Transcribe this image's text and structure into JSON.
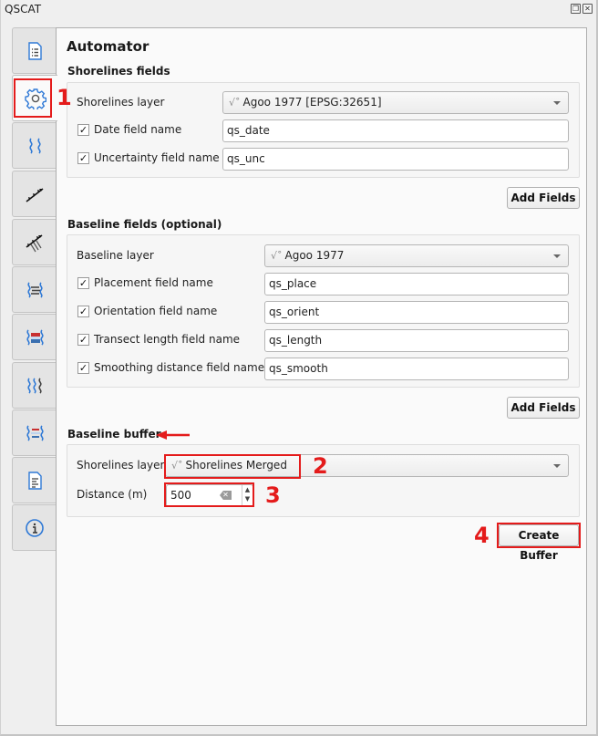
{
  "window": {
    "title": "QSCAT",
    "float_button": "restore-icon",
    "close_button": "close-icon"
  },
  "tabs": [
    {
      "name": "project-settings",
      "icon": "list-document-icon",
      "active": false
    },
    {
      "name": "automator",
      "icon": "gear-icon",
      "active": true
    },
    {
      "name": "shorelines",
      "icon": "shoreline-waves-icon",
      "active": false
    },
    {
      "name": "transects-cast",
      "icon": "transect-arrows-icon",
      "active": false
    },
    {
      "name": "transects-multi",
      "icon": "multi-transect-arrows-icon",
      "active": false
    },
    {
      "name": "shoreline-change",
      "icon": "shoreline-change-icon",
      "active": false
    },
    {
      "name": "area-change",
      "icon": "area-change-icon",
      "active": false
    },
    {
      "name": "forecasting",
      "icon": "triple-waves-icon",
      "active": false
    },
    {
      "name": "summary",
      "icon": "summary-change-icon",
      "active": false
    },
    {
      "name": "report",
      "icon": "report-document-icon",
      "active": false
    },
    {
      "name": "about",
      "icon": "info-icon",
      "active": false
    }
  ],
  "page": {
    "title": "Automator"
  },
  "shorelines_fields": {
    "title": "Shorelines fields",
    "layer_label": "Shorelines layer",
    "layer_value": "Agoo 1977 [EPSG:32651]",
    "rows": [
      {
        "label": "Date field name",
        "checked": true,
        "value": "qs_date"
      },
      {
        "label": "Uncertainty field name",
        "checked": true,
        "value": "qs_unc"
      }
    ],
    "add_button": "Add Fields"
  },
  "baseline_fields": {
    "title": "Baseline fields (optional)",
    "layer_label": "Baseline layer",
    "layer_value": "Agoo 1977",
    "rows": [
      {
        "label": "Placement field name",
        "checked": true,
        "value": "qs_place"
      },
      {
        "label": "Orientation field name",
        "checked": true,
        "value": "qs_orient"
      },
      {
        "label": "Transect length field name",
        "checked": true,
        "value": "qs_length"
      },
      {
        "label": "Smoothing distance field name",
        "checked": true,
        "value": "qs_smooth"
      }
    ],
    "add_button": "Add Fields"
  },
  "baseline_buffer": {
    "title": "Baseline buffer",
    "layer_label": "Shorelines layer",
    "layer_value": "Shorelines Merged",
    "distance_label": "Distance (m)",
    "distance_value": "500",
    "create_button": "Create Buffer"
  },
  "annotations": {
    "step1": "1",
    "step2": "2",
    "step3": "3",
    "step4": "4",
    "color": "#e41b1b"
  },
  "check_mark": "✓",
  "layer_glyph": "\\/˚"
}
